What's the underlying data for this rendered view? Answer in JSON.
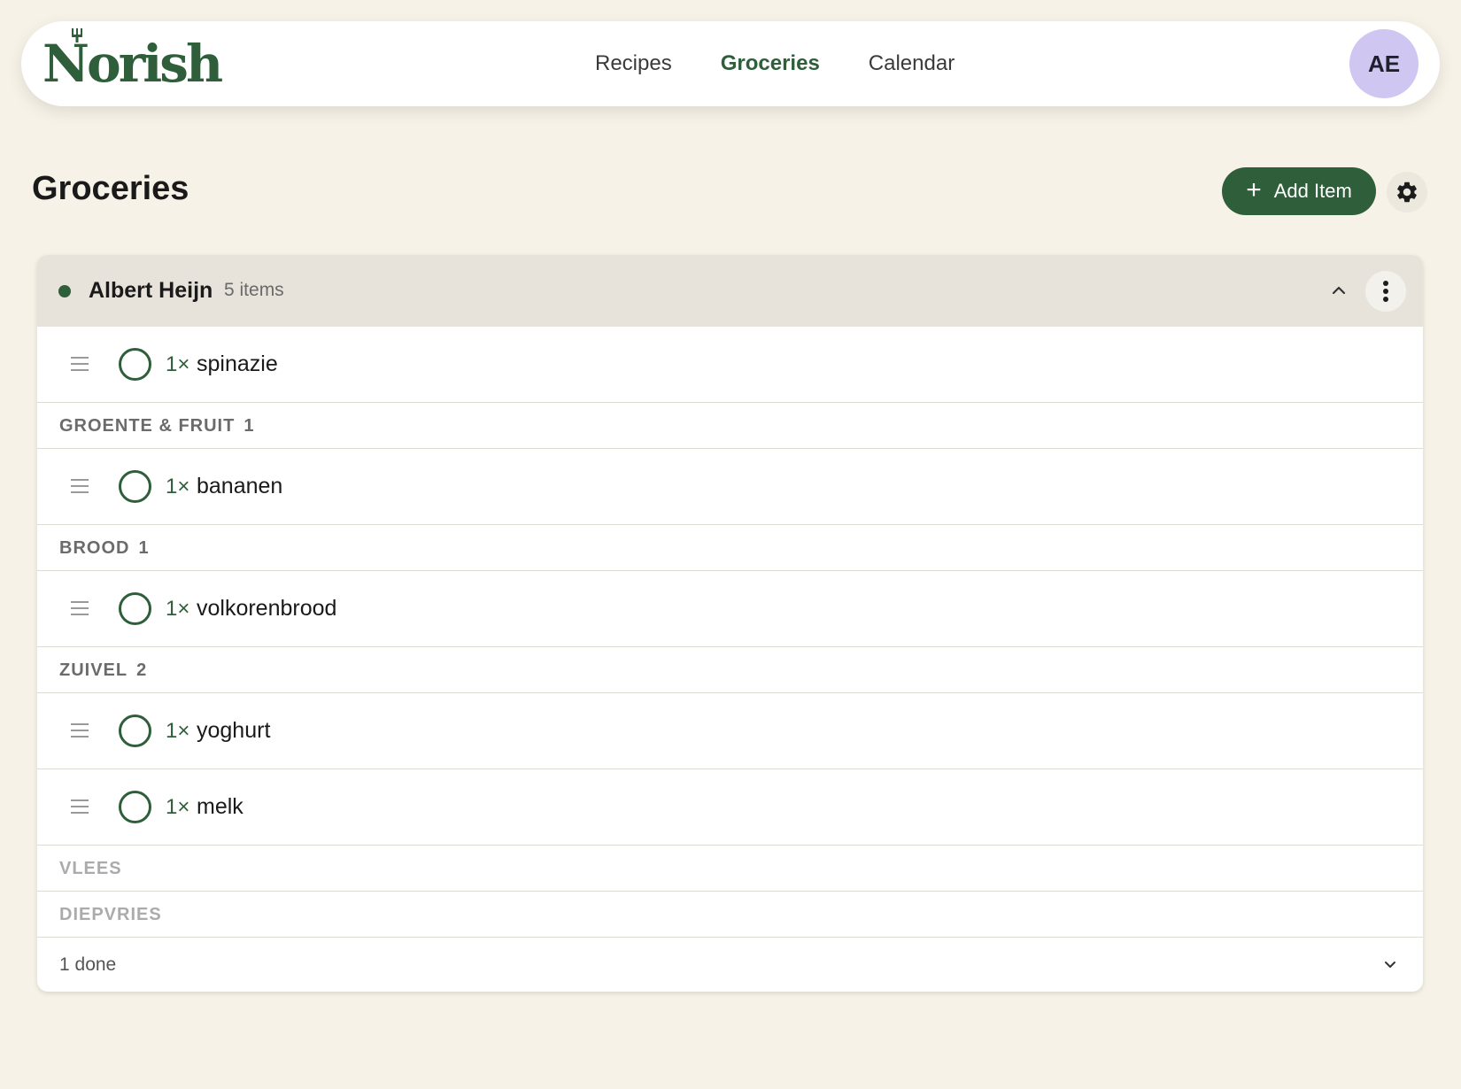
{
  "app": {
    "logo_text": "Norish"
  },
  "nav": {
    "links": [
      {
        "label": "Recipes",
        "active": false
      },
      {
        "label": "Groceries",
        "active": true
      },
      {
        "label": "Calendar",
        "active": false
      }
    ],
    "avatar_initials": "AE"
  },
  "page": {
    "title": "Groceries",
    "add_button_label": "Add Item"
  },
  "store": {
    "name": "Albert Heijn",
    "count_label": "5 items",
    "uncategorized_items": [
      {
        "qty": "1×",
        "name": "spinazie"
      }
    ],
    "categories": [
      {
        "label": "GROENTE & FRUIT",
        "count": "1",
        "items": [
          {
            "qty": "1×",
            "name": "bananen"
          }
        ]
      },
      {
        "label": "BROOD",
        "count": "1",
        "items": [
          {
            "qty": "1×",
            "name": "volkorenbrood"
          }
        ]
      },
      {
        "label": "ZUIVEL",
        "count": "2",
        "items": [
          {
            "qty": "1×",
            "name": "yoghurt"
          },
          {
            "qty": "1×",
            "name": "melk"
          }
        ]
      },
      {
        "label": "VLEES",
        "count": "",
        "items": []
      },
      {
        "label": "DIEPVRIES",
        "count": "",
        "items": []
      }
    ],
    "done_label": "1 done"
  },
  "colors": {
    "accent": "#2e5e3a",
    "background": "#f6f2e7",
    "avatar": "#cfc6f1"
  }
}
